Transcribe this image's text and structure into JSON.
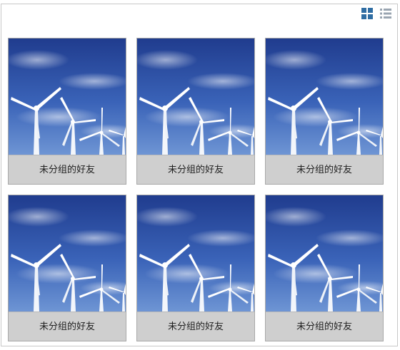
{
  "toolbar": {
    "grid_view_icon": "grid-view-icon",
    "list_view_icon": "list-view-icon",
    "active_color": "#2f6da3",
    "inactive_color": "#9aa5b1"
  },
  "cards": [
    {
      "label": "未分组的好友",
      "image": "wind-turbines-photo"
    },
    {
      "label": "未分组的好友",
      "image": "wind-turbines-photo"
    },
    {
      "label": "未分组的好友",
      "image": "wind-turbines-photo"
    },
    {
      "label": "未分组的好友",
      "image": "wind-turbines-photo"
    },
    {
      "label": "未分组的好友",
      "image": "wind-turbines-photo"
    },
    {
      "label": "未分组的好友",
      "image": "wind-turbines-photo"
    }
  ]
}
